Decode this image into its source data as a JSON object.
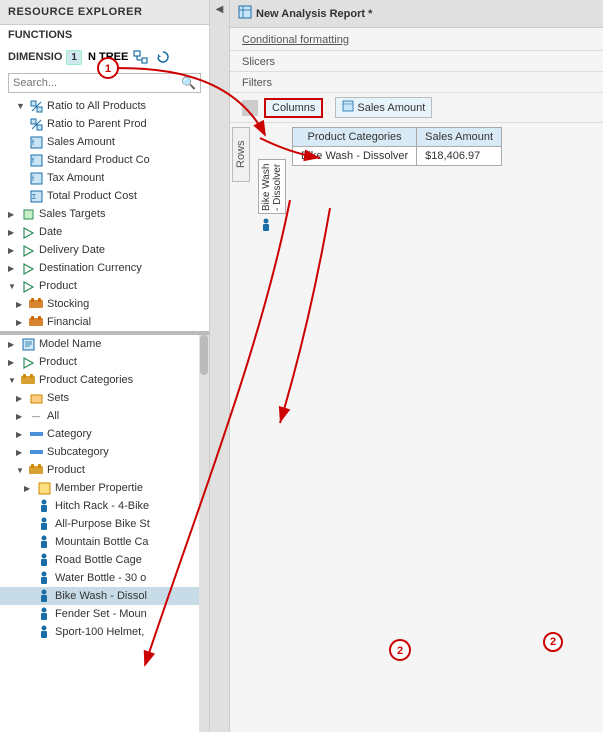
{
  "header": {
    "title": "New Analysis Report *"
  },
  "leftPanel": {
    "resourceExplorer": "RESOURCE EXPLORER",
    "functions": "FUNCTIONS",
    "dimensions": "DIMENSIO",
    "badge": "1",
    "searchPlaceholder": "Search...",
    "topTree": [
      {
        "label": "Ratio to All Products",
        "icon": "ratio",
        "indent": 1,
        "expanded": true
      },
      {
        "label": "Ratio to Parent Prod",
        "icon": "ratio",
        "indent": 1,
        "expanded": false
      },
      {
        "label": "Sales Amount",
        "icon": "table",
        "indent": 1,
        "expanded": false
      },
      {
        "label": "Standard Product Co",
        "icon": "table",
        "indent": 1,
        "expanded": false
      },
      {
        "label": "Tax Amount",
        "icon": "table",
        "indent": 1,
        "expanded": false
      },
      {
        "label": "Total Product Cost",
        "icon": "table",
        "indent": 1,
        "expanded": false
      },
      {
        "label": "Sales Targets",
        "icon": "folder",
        "indent": 0,
        "expanded": false
      },
      {
        "label": "Date",
        "icon": "date",
        "indent": 0,
        "expanded": false
      },
      {
        "label": "Delivery Date",
        "icon": "date",
        "indent": 0,
        "expanded": false
      },
      {
        "label": "Destination Currency",
        "icon": "date",
        "indent": 0,
        "expanded": false
      },
      {
        "label": "Product",
        "icon": "product",
        "indent": 0,
        "expanded": true
      },
      {
        "label": "Stocking",
        "icon": "stocking",
        "indent": 1,
        "expanded": false
      },
      {
        "label": "Financial",
        "icon": "financial",
        "indent": 1,
        "expanded": false
      }
    ],
    "bottomTree": [
      {
        "label": "Model Name",
        "icon": "table",
        "indent": 0,
        "expanded": false
      },
      {
        "label": "Product",
        "icon": "product",
        "indent": 0,
        "expanded": false
      },
      {
        "label": "Product Categories",
        "icon": "cat",
        "indent": 0,
        "expanded": true
      },
      {
        "label": "Sets",
        "icon": "sets",
        "indent": 1,
        "expanded": false
      },
      {
        "label": "All",
        "icon": "all",
        "indent": 1,
        "expanded": false
      },
      {
        "label": "Category",
        "icon": "subcategory",
        "indent": 1,
        "expanded": false
      },
      {
        "label": "Subcategory",
        "icon": "subcategory",
        "indent": 1,
        "expanded": false
      },
      {
        "label": "Product",
        "icon": "product",
        "indent": 1,
        "expanded": true
      },
      {
        "label": "Member Propertie",
        "icon": "member",
        "indent": 2,
        "expanded": false
      },
      {
        "label": "Hitch Rack - 4-Bike",
        "icon": "person",
        "indent": 2
      },
      {
        "label": "All-Purpose Bike St",
        "icon": "person",
        "indent": 2
      },
      {
        "label": "Mountain Bottle Ca",
        "icon": "person",
        "indent": 2
      },
      {
        "label": "Road Bottle Cage",
        "icon": "person",
        "indent": 2
      },
      {
        "label": "Water Bottle - 30 o",
        "icon": "person",
        "indent": 2
      },
      {
        "label": "Bike Wash - Dissol",
        "icon": "person",
        "indent": 2
      },
      {
        "label": "Fender Set - Moun",
        "icon": "person",
        "indent": 2
      },
      {
        "label": "Sport-100 Helmet,",
        "icon": "person",
        "indent": 2
      }
    ]
  },
  "rightPanel": {
    "conditionalFormatting": "Conditional formatting",
    "slicers": "Slicers",
    "filters": "Filters",
    "columnsLabel": "Columns",
    "salesAmount": "Sales Amount",
    "rowsLabel": "Rows",
    "table": {
      "headers": [
        "Product Categories",
        "Sales Amount"
      ],
      "rows": [
        [
          "Bike Wash - Dissolver",
          "$18,406.97"
        ]
      ]
    },
    "bikeWashVertical": "Bike Wash - Dissolver"
  },
  "annotations": {
    "one": "1",
    "two": "2"
  }
}
